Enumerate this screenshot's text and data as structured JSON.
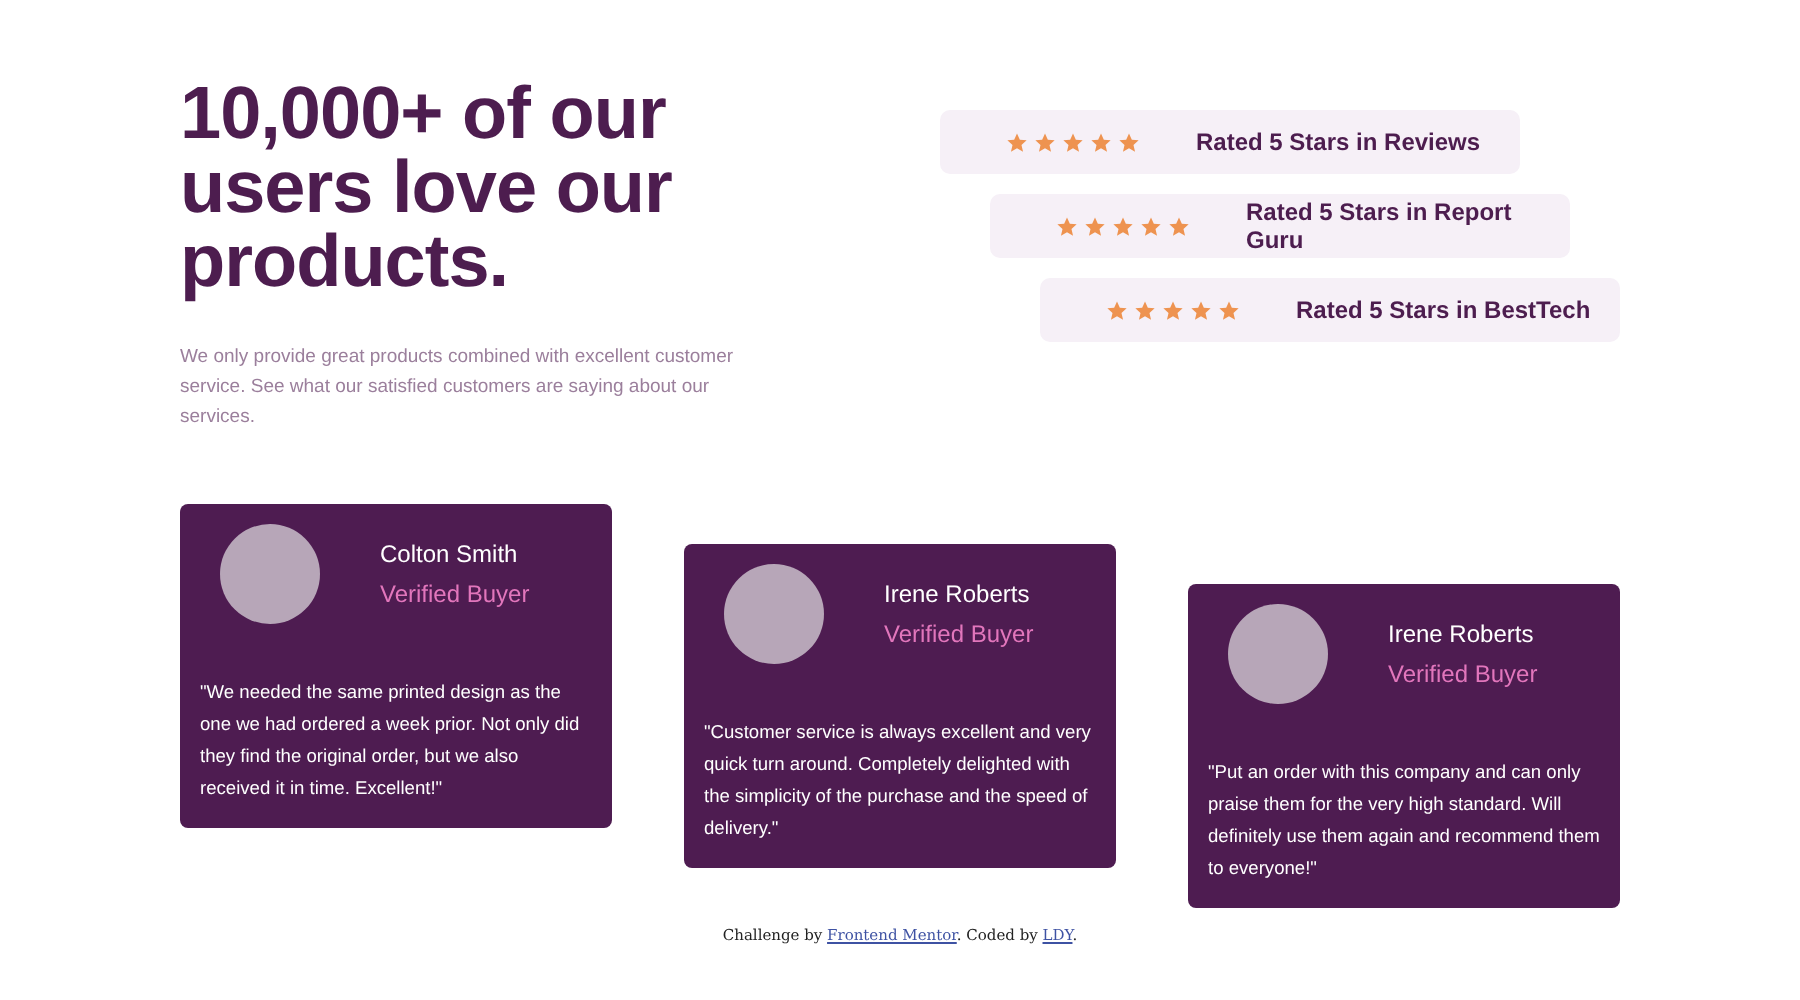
{
  "heading": "10,000+ of our users love our products.",
  "intro": "We only provide great products combined with excellent customer service. See what our satisfied customers are saying about our services.",
  "ratings": [
    {
      "stars": 5,
      "label": "Rated 5 Stars in Reviews"
    },
    {
      "stars": 5,
      "label": "Rated 5 Stars in Report Guru"
    },
    {
      "stars": 5,
      "label": "Rated 5 Stars in BestTech"
    }
  ],
  "testimonials": [
    {
      "name": "Colton Smith",
      "role": "Verified Buyer",
      "quote": "\"We needed the same printed design as the one we had ordered a week prior. Not only did they find the original order, but we also received it in time. Excellent!\""
    },
    {
      "name": "Irene Roberts",
      "role": "Verified Buyer",
      "quote": "\"Customer service is always excellent and very quick turn around. Completely delighted with the simplicity of the purchase and the speed of delivery.\""
    },
    {
      "name": "Irene Roberts",
      "role": "Verified Buyer",
      "quote": "\"Put an order with this company and can only praise them for the very high standard. Will definitely use them again and recommend them to everyone!\""
    }
  ],
  "footer": {
    "prefix": "Challenge by ",
    "link1": "Frontend Mentor",
    "middle": ". Coded by ",
    "link2": "LDY",
    "suffix": "."
  }
}
